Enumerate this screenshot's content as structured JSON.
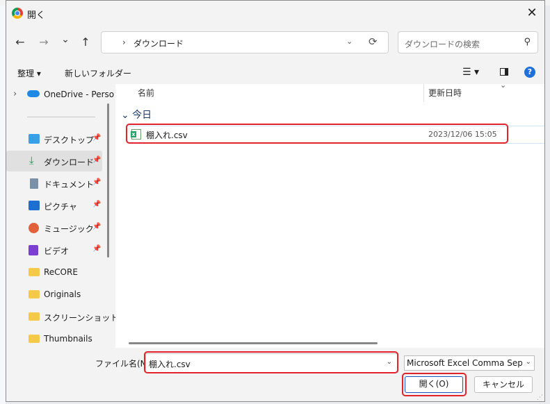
{
  "window": {
    "title": "開く",
    "close_label": "✕"
  },
  "nav": {
    "back_icon": "←",
    "forward_icon": "→",
    "recent_icon": "⌄",
    "up_icon": "↑",
    "breadcrumb_sep": "›",
    "path": "ダウンロード",
    "dropdown_icon": "⌄",
    "refresh_icon": "⟳",
    "search_placeholder": "ダウンロードの検索",
    "search_icon": "⚲"
  },
  "commandbar": {
    "organize_label": "整理 ▾",
    "new_folder_label": "新しいフォルダー",
    "view_label": "☰ ▾",
    "help_label": "?"
  },
  "sidebar": {
    "onedrive_chevron": "›",
    "items": [
      {
        "label": "OneDrive - Perso",
        "icon": "cloud-icon",
        "pinned": false
      },
      {
        "label": "デスクトップ",
        "icon": "desktop-icon",
        "pinned": true
      },
      {
        "label": "ダウンロード",
        "icon": "download-icon",
        "pinned": true,
        "selected": true
      },
      {
        "label": "ドキュメント",
        "icon": "document-icon",
        "pinned": true
      },
      {
        "label": "ピクチャ",
        "icon": "picture-icon",
        "pinned": true
      },
      {
        "label": "ミュージック",
        "icon": "music-icon",
        "pinned": true
      },
      {
        "label": "ビデオ",
        "icon": "video-icon",
        "pinned": true
      },
      {
        "label": "ReCORE",
        "icon": "folder-icon",
        "pinned": false
      },
      {
        "label": "Originals",
        "icon": "folder-icon",
        "pinned": false
      },
      {
        "label": "スクリーンショット",
        "icon": "folder-icon",
        "pinned": false
      },
      {
        "label": "Thumbnails",
        "icon": "folder-icon",
        "pinned": false
      }
    ],
    "pin_glyph": "📌"
  },
  "content": {
    "col_name": "名前",
    "col_date": "更新日時",
    "sort_chevron": "⌄",
    "group_label": "⌄ 今日",
    "files": [
      {
        "name": "棚入れ.csv",
        "date": "2023/12/06 15:05",
        "icon": "excel-csv-icon"
      }
    ]
  },
  "footer": {
    "filename_label": "ファイル名(N):",
    "filename_value": "棚入れ.csv",
    "filename_dropdown": "⌄",
    "filetype_value": "Microsoft Excel Comma Separat",
    "filetype_dropdown": "⌄",
    "open_label": "開く(O)",
    "cancel_label": "キャンセル"
  },
  "colors": {
    "highlight": "#e2232b",
    "accent": "#1a56c4"
  }
}
